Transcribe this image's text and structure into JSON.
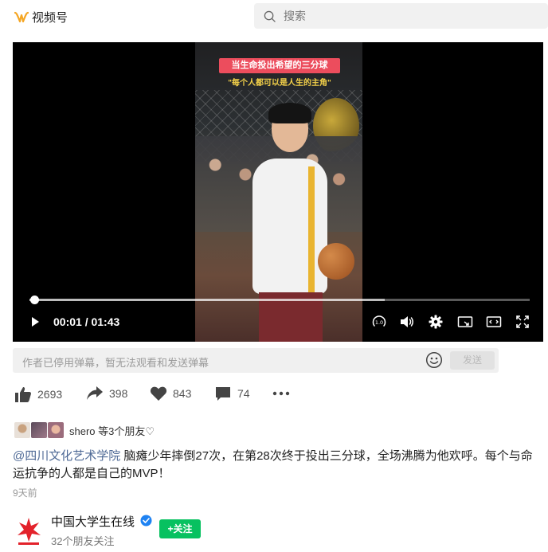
{
  "header": {
    "app_name": "视频号",
    "search_placeholder": "搜索"
  },
  "video": {
    "banner_title": "当生命投出希望的三分球",
    "banner_subtitle": "\"每个人都可以是人生的主角\"",
    "current_time": "00:01",
    "total_time": "01:43",
    "time_display": "00:01 / 01:43",
    "progress_fraction": 0.0097,
    "buffered_fraction": 0.71,
    "icons": [
      "play-icon",
      "speed-icon",
      "volume-icon",
      "settings-icon",
      "pip-icon",
      "theater-icon",
      "fullscreen-icon"
    ]
  },
  "danmu": {
    "placeholder": "作者已停用弹幕，暂无法观看和发送弹幕",
    "send_label": "发送"
  },
  "actions": {
    "likes": "2693",
    "shares": "398",
    "favorites": "843",
    "comments": "74"
  },
  "friends": {
    "text": "shero 等3个朋友♡"
  },
  "description": {
    "mention": "@四川文化艺术学院",
    "text": " 脑瘫少年摔倒27次，在第28次终于投出三分球，全场沸腾为他欢呼。每个与命运抗争的人都是自己的MVP！"
  },
  "posted": "9天前",
  "author": {
    "name": "中国大学生在线",
    "follow_label": "+关注",
    "friends_following": "32个朋友关注"
  },
  "colors": {
    "accent_green": "#07c160",
    "logo_orange": "#f5a623",
    "banner_red": "#ec4d5d",
    "mention_blue": "#4f6a96",
    "verified_blue": "#1e82f2",
    "author_red": "#e3222b"
  }
}
